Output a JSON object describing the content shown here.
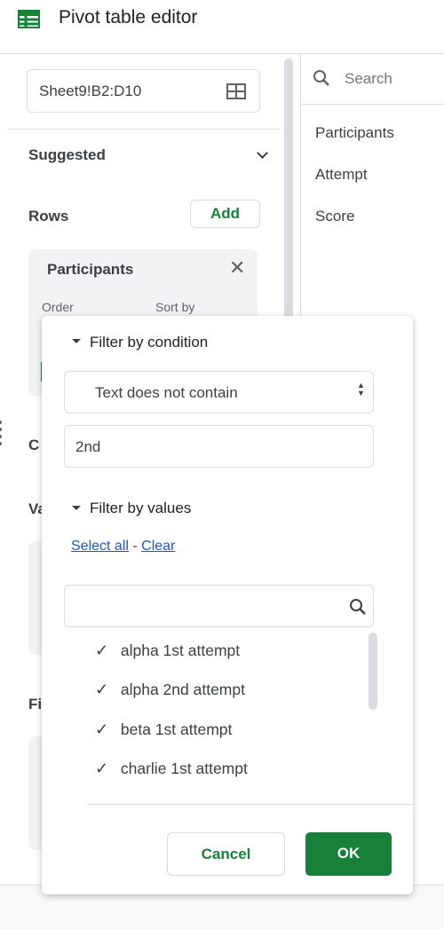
{
  "header": {
    "title": "Pivot table editor",
    "icon": "sheets-icon",
    "accent": "#188038"
  },
  "editor": {
    "range": "Sheet9!B2:D10",
    "suggested": "Suggested",
    "rows_label": "Rows",
    "add_label": "Add",
    "row_card": {
      "title": "Participants",
      "order_label": "Order",
      "sort_by_label": "Sort by"
    },
    "columns_partial": "C",
    "values_partial": "Va",
    "filters_partial": "Fi"
  },
  "fields": {
    "search_placeholder": "Search",
    "items": [
      "Participants",
      "Attempt",
      "Score"
    ]
  },
  "filter_popup": {
    "condition_header": "Filter by condition",
    "condition_value": "Text does not contain",
    "condition_input": "2nd",
    "values_header": "Filter by values",
    "select_all": "Select all",
    "separator": "-",
    "clear": "Clear",
    "search_value": "",
    "values": [
      {
        "label": "alpha 1st attempt",
        "checked": true
      },
      {
        "label": "alpha 2nd attempt",
        "checked": true
      },
      {
        "label": "beta 1st attempt",
        "checked": true
      },
      {
        "label": "charlie 1st attempt",
        "checked": true
      }
    ],
    "cancel": "Cancel",
    "ok": "OK"
  }
}
